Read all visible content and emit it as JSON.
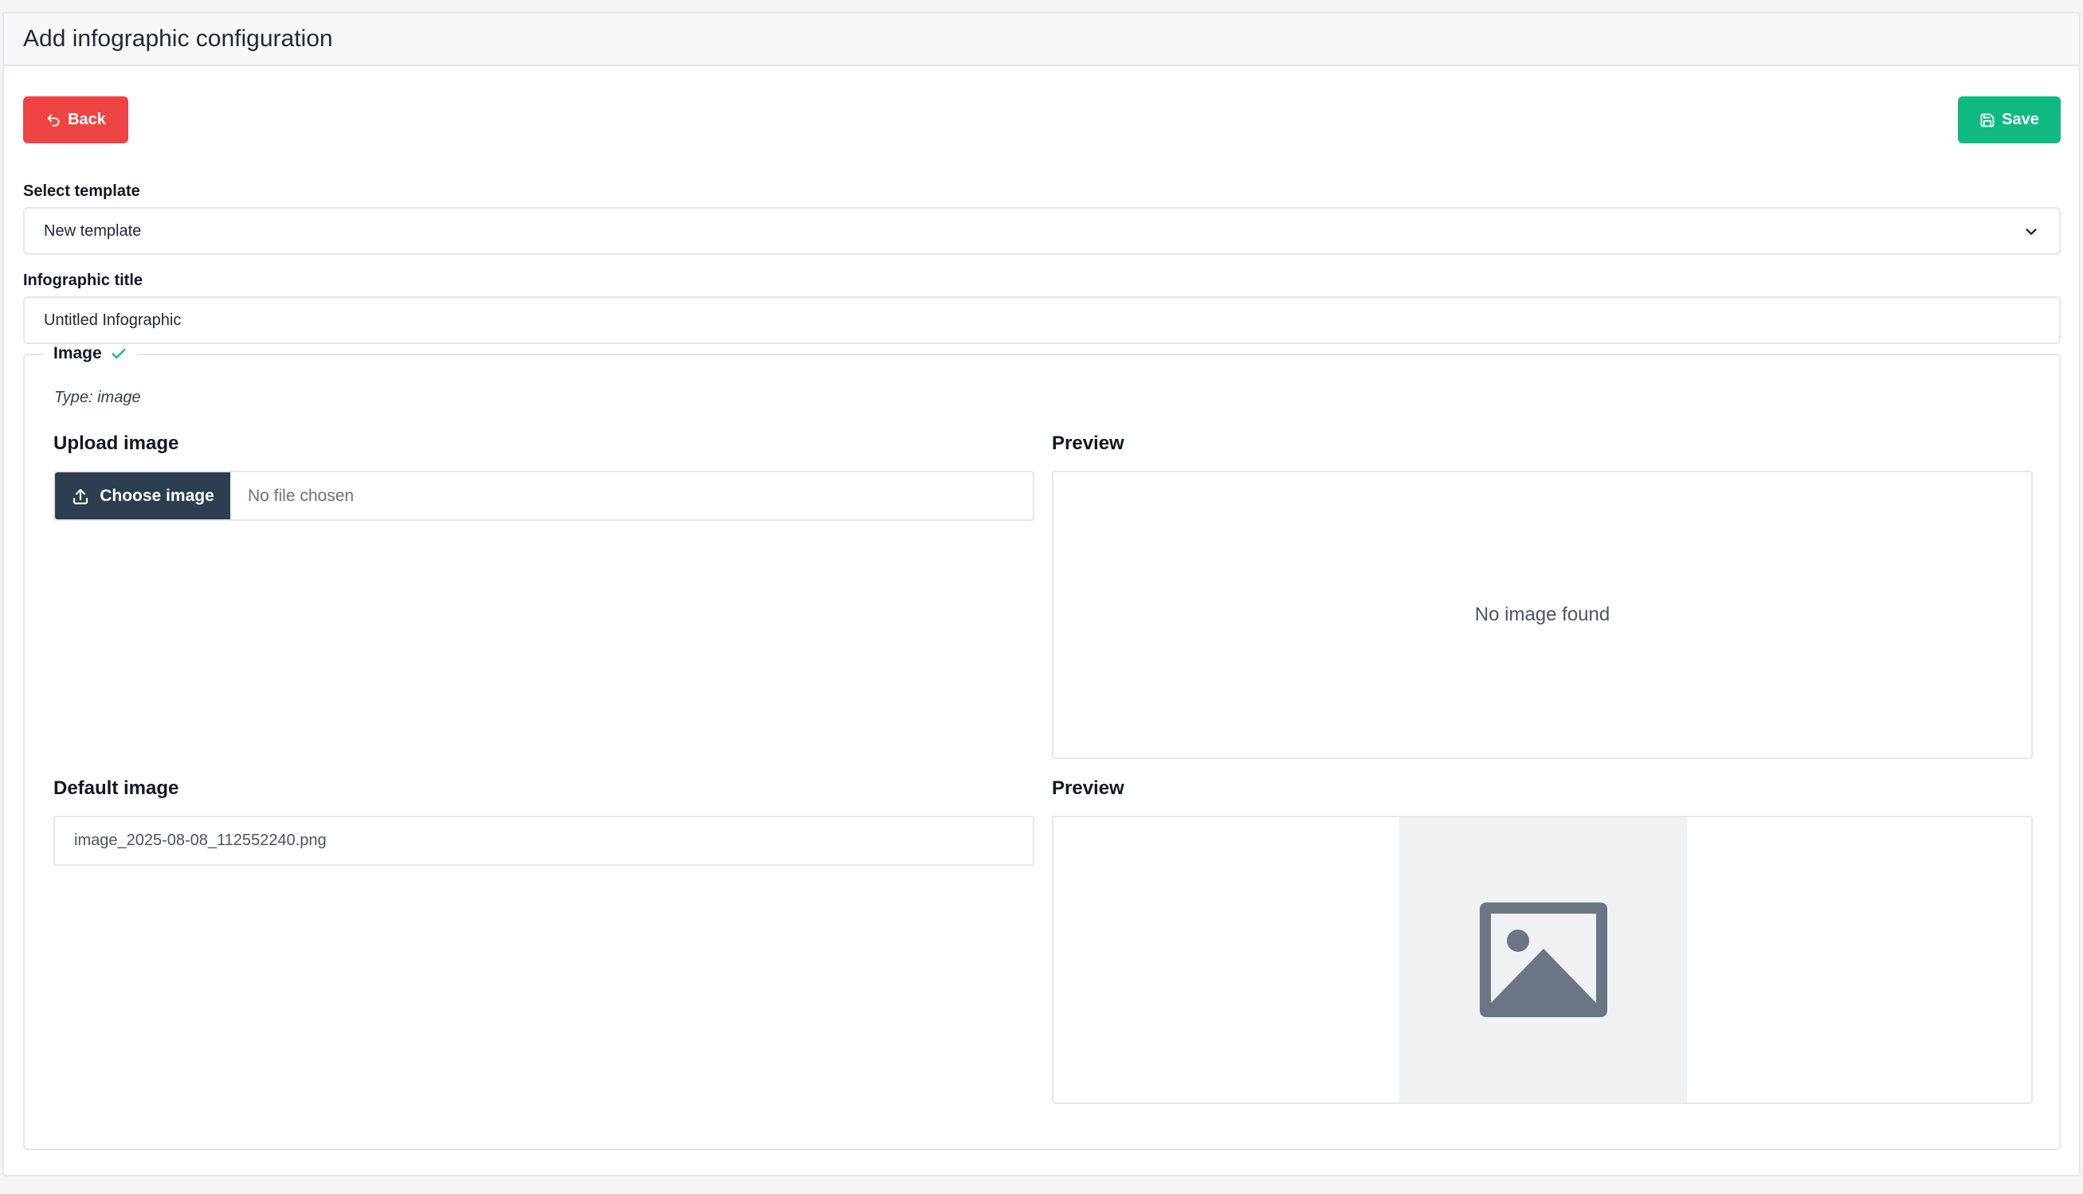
{
  "header": {
    "title": "Add infographic configuration"
  },
  "toolbar": {
    "back_label": "Back",
    "save_label": "Save"
  },
  "template": {
    "label": "Select template",
    "selected": "New template"
  },
  "title_field": {
    "label": "Infographic title",
    "value": "Untitled Infographic"
  },
  "image_section": {
    "legend": "Image",
    "type_text": "Type: image",
    "upload": {
      "title": "Upload image",
      "button_label": "Choose image",
      "status": "No file chosen"
    },
    "preview_title": "Preview",
    "no_image_text": "No image found",
    "default": {
      "title": "Default image",
      "filename": "image_2025-08-08_112552240.png"
    },
    "default_preview_title": "Preview"
  },
  "colors": {
    "back": "#ef4444",
    "save": "#10b981",
    "choose_button": "#2d3e50",
    "check": "#10b981",
    "placeholder_icon": "#6b7685"
  },
  "icons": {
    "back": "undo-arrow-icon",
    "save": "floppy-disk-icon",
    "dropdown": "chevron-down-icon",
    "check": "check-icon",
    "upload": "upload-icon",
    "placeholder": "image-placeholder-icon"
  }
}
